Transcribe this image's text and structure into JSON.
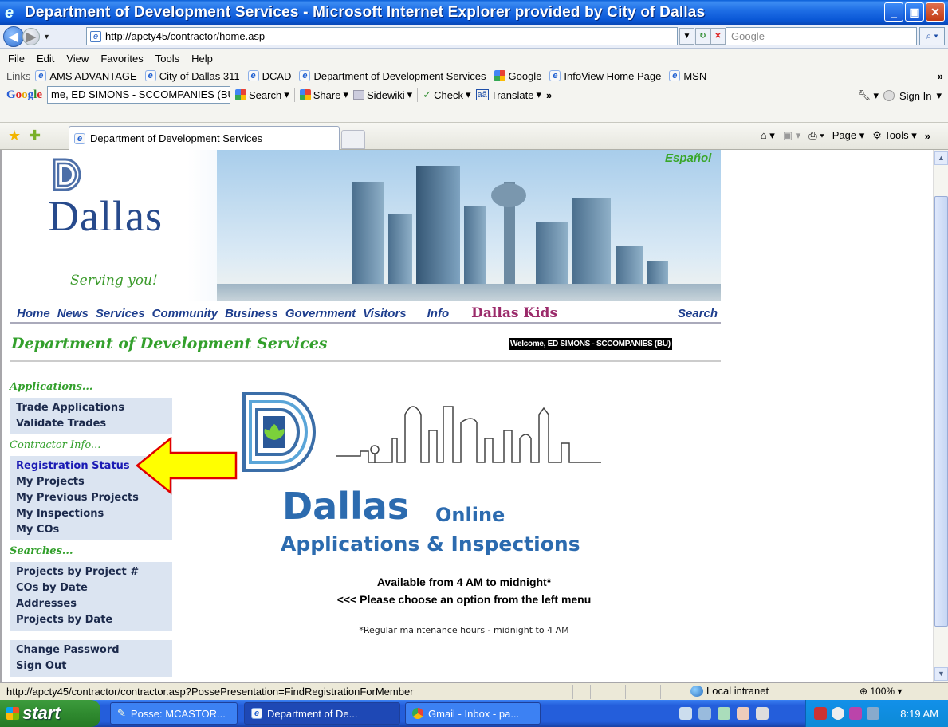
{
  "window": {
    "title": "Department of Development Services - Microsoft Internet Explorer provided by City of Dallas",
    "minimize": "_",
    "maximize": "▣",
    "close": "✕"
  },
  "address_bar": {
    "url": "http://apcty45/contractor/home.asp",
    "search_placeholder": "Google"
  },
  "menu": [
    "File",
    "Edit",
    "View",
    "Favorites",
    "Tools",
    "Help"
  ],
  "links_bar": {
    "label": "Links",
    "items": [
      "AMS ADVANTAGE",
      "City of Dallas 311",
      "DCAD",
      "Department of Development Services",
      "Google",
      "InfoView Home Page",
      "MSN"
    ],
    "more": "»"
  },
  "google_toolbar": {
    "logo": "Google",
    "combo_value": "me, ED SIMONS - SCCOMPANIES (BU)",
    "search_label": "Search",
    "share_label": "Share",
    "sidewiki_label": "Sidewiki",
    "check_label": "Check",
    "translate_label": "Translate",
    "more": "»",
    "signin_label": "Sign In"
  },
  "tabs": {
    "active_tab": "Department of Development Services",
    "page_label": "Page",
    "tools_label": "Tools",
    "more": "»"
  },
  "page": {
    "espanol": "Español",
    "logo_word": "Dallas",
    "tagline": "Serving you!",
    "top_nav": [
      "Home",
      "News",
      "Services",
      "Community",
      "Business",
      "Government",
      "Visitors",
      "Info"
    ],
    "kids": "Dallas Kids",
    "search": "Search",
    "dept_title": "Department of Development Services",
    "welcome": "Welcome, ED SIMONS - SCCOMPANIES (BU)",
    "left_nav": {
      "applications_heading": "Applications...",
      "applications": [
        "Trade Applications",
        "Validate Trades"
      ],
      "contractor_heading": "Contractor Info...",
      "contractor": [
        "Registration Status",
        "My Projects",
        "My Previous Projects",
        "My Inspections",
        "My COs"
      ],
      "searches_heading": "Searches...",
      "searches": [
        "Projects by Project #",
        "COs by Date",
        "Addresses",
        "Projects by Date"
      ],
      "account": [
        "Change Password",
        "Sign Out"
      ]
    },
    "center": {
      "dallas": "Dallas",
      "online": "Online",
      "apps_inspections": "Applications & Inspections",
      "available": "Available from 4 AM to midnight*",
      "choose": "<<< Please choose an option from the left menu",
      "maintenance": "*Regular maintenance hours - midnight to 4 AM"
    }
  },
  "status_bar": {
    "url": "http://apcty45/contractor/contractor.asp?PossePresentation=FindRegistrationForMember",
    "zone": "Local intranet",
    "zoom": "100%"
  },
  "taskbar": {
    "start": "start",
    "tasks": [
      "Posse: MCASTOR...",
      "Department of De...",
      "Gmail - Inbox - pa..."
    ],
    "clock": "8:19 AM"
  }
}
